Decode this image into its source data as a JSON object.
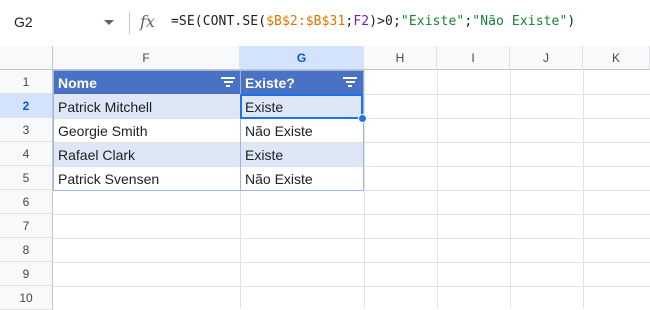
{
  "formula_bar": {
    "cell_ref": "G2",
    "fx_label": "fx",
    "formula_parts": [
      "=SE(CONT.SE(",
      "$B$2:$B$31",
      ";",
      "F2",
      ")>0;",
      "\"Existe\"",
      ";",
      "\"Não Existe\"",
      ")"
    ]
  },
  "columns": [
    "F",
    "G",
    "H",
    "I",
    "J",
    "K"
  ],
  "selected_column": "G",
  "rows": [
    "1",
    "2",
    "3",
    "4",
    "5",
    "6",
    "7",
    "8",
    "9",
    "10"
  ],
  "selected_row": "2",
  "table": {
    "headers": [
      "Nome",
      "Existe?"
    ],
    "rows": [
      [
        "Patrick Mitchell",
        "Existe"
      ],
      [
        "Georgie Smith",
        "Não Existe"
      ],
      [
        "Rafael Clark",
        "Existe"
      ],
      [
        "Patrick Svensen",
        "Não Existe"
      ]
    ]
  },
  "colors": {
    "header_fill": "#4a72c4",
    "band_fill": "#dde7f5",
    "selection": "#1a73e8",
    "ref_orange": "#e37400",
    "ref_purple": "#7b1fa2",
    "string_green": "#188038"
  }
}
